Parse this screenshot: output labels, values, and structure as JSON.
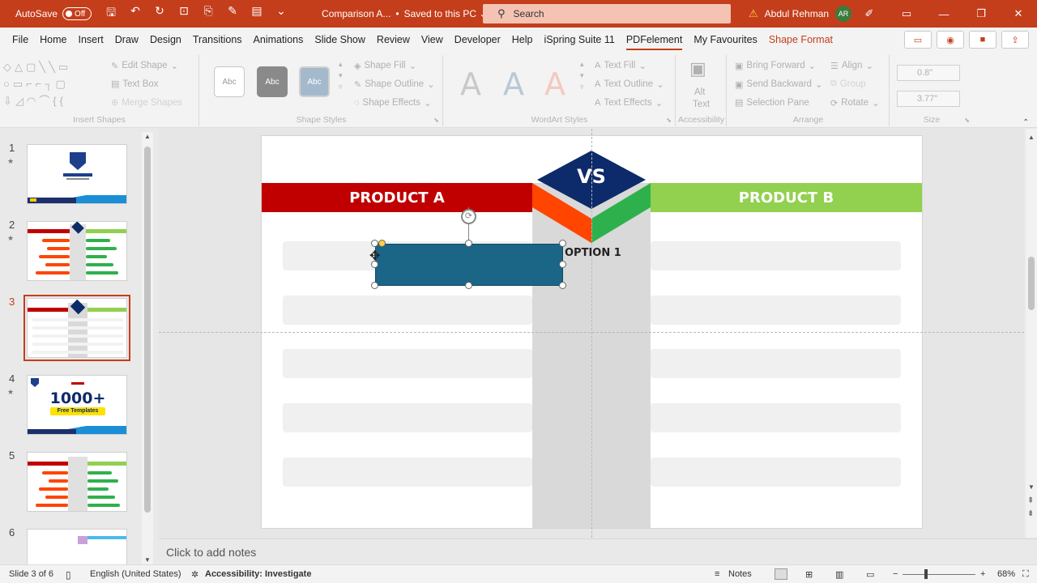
{
  "titlebar": {
    "autosave_label": "AutoSave",
    "autosave_state": "Off",
    "doc_name": "Comparison A...",
    "saved_status": "Saved to this PC",
    "search_placeholder": "Search",
    "user_name": "Abdul Rehman",
    "user_initials": "AR"
  },
  "tabs": [
    "File",
    "Home",
    "Insert",
    "Draw",
    "Design",
    "Transitions",
    "Animations",
    "Slide Show",
    "Review",
    "View",
    "Developer",
    "Help",
    "iSpring Suite 11",
    "PDFelement",
    "My Favourites",
    "Shape Format"
  ],
  "ribbon": {
    "insert_shapes": {
      "label": "Insert Shapes",
      "edit_shape": "Edit Shape",
      "text_box": "Text Box",
      "merge_shapes": "Merge Shapes"
    },
    "shape_styles": {
      "label": "Shape Styles",
      "style_sample": "Abc",
      "shape_fill": "Shape Fill",
      "shape_outline": "Shape Outline",
      "shape_effects": "Shape Effects"
    },
    "wordart": {
      "label": "WordArt Styles",
      "letter": "A",
      "text_fill": "Text Fill",
      "text_outline": "Text Outline",
      "text_effects": "Text Effects"
    },
    "accessibility": {
      "label": "Accessibility",
      "alt_text_1": "Alt",
      "alt_text_2": "Text"
    },
    "arrange": {
      "label": "Arrange",
      "bring_forward": "Bring Forward",
      "send_backward": "Send Backward",
      "selection_pane": "Selection Pane",
      "align": "Align",
      "group": "Group",
      "rotate": "Rotate"
    },
    "size": {
      "label": "Size",
      "height": "0.8\"",
      "width": "3.77\""
    }
  },
  "thumbnails": [
    {
      "num": "1",
      "star": true
    },
    {
      "num": "2",
      "star": true
    },
    {
      "num": "3",
      "star": false
    },
    {
      "num": "4",
      "star": true,
      "big_text": "1000+",
      "sub_text": "Free Templates"
    },
    {
      "num": "5",
      "star": false
    },
    {
      "num": "6",
      "star": false
    }
  ],
  "slide": {
    "product_a": "PRODUCT A",
    "product_b": "PRODUCT B",
    "vs": "VS",
    "option_label": "OPTION 1",
    "colors": {
      "red": "#c00000",
      "green": "#92d050",
      "orange": "#ff4500",
      "dark_green": "#2eb14c",
      "navy": "#0d2a6a",
      "teal": "#1b6587",
      "gray_band": "#d9d9d9"
    }
  },
  "notes_placeholder": "Click to add notes",
  "status": {
    "slide_info": "Slide 3 of 6",
    "language": "English (United States)",
    "accessibility": "Accessibility: Investigate",
    "notes": "Notes",
    "zoom": "68%"
  }
}
